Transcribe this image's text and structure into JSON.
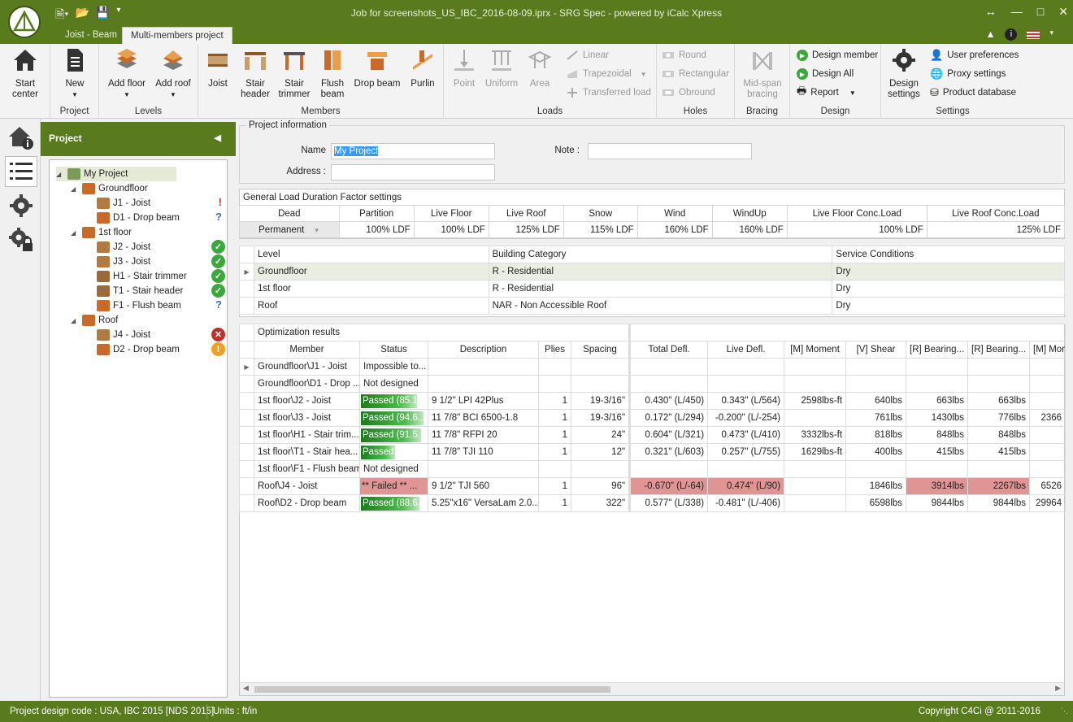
{
  "window": {
    "title": "Job for screenshots_US_IBC_2016-08-09.iprx - SRG Spec - powered by iCalc Xpress",
    "tabs": [
      "Joist - Beam",
      "Multi-members project"
    ],
    "active_tab": "Multi-members project"
  },
  "ribbon": {
    "project": {
      "label": "Project",
      "start_center": "Start center",
      "new": "New"
    },
    "levels": {
      "label": "Levels",
      "add_floor": "Add floor",
      "add_roof": "Add roof"
    },
    "members": {
      "label": "Members",
      "joist": "Joist",
      "stair_header": "Stair header",
      "stair_trimmer": "Stair trimmer",
      "flush_beam": "Flush beam",
      "drop_beam": "Drop beam",
      "purlin": "Purlin"
    },
    "loads": {
      "label": "Loads",
      "point": "Point",
      "uniform": "Uniform",
      "area": "Area",
      "linear": "Linear",
      "trapezoidal": "Trapezoidal",
      "transferred": "Transferred load"
    },
    "holes": {
      "label": "Holes",
      "round": "Round",
      "rectangular": "Rectangular",
      "obround": "Obround"
    },
    "bracing": {
      "label": "Bracing",
      "midspan": "Mid-span bracing"
    },
    "design": {
      "label": "Design",
      "design_member": "Design member",
      "design_all": "Design All",
      "report": "Report"
    },
    "settings": {
      "label": "Settings",
      "design_settings": "Design settings",
      "user_prefs": "User preferences",
      "proxy": "Proxy settings",
      "product_db": "Product database"
    }
  },
  "project_panel": {
    "title": "Project",
    "tree": [
      {
        "label": "My Project",
        "level": 0,
        "status": "",
        "kind": "project"
      },
      {
        "label": "Groundfloor",
        "level": 1,
        "status": "",
        "kind": "level"
      },
      {
        "label": "J1 - Joist",
        "level": 2,
        "status": "warn-red",
        "kind": "joist"
      },
      {
        "label": "D1 - Drop beam",
        "level": 2,
        "status": "question",
        "kind": "beam"
      },
      {
        "label": "1st floor",
        "level": 1,
        "status": "",
        "kind": "level"
      },
      {
        "label": "J2 - Joist",
        "level": 2,
        "status": "ok",
        "kind": "joist"
      },
      {
        "label": "J3 - Joist",
        "level": 2,
        "status": "ok",
        "kind": "joist"
      },
      {
        "label": "H1 - Stair trimmer",
        "level": 2,
        "status": "ok",
        "kind": "stair"
      },
      {
        "label": "T1 - Stair header",
        "level": 2,
        "status": "ok",
        "kind": "stair"
      },
      {
        "label": "F1 - Flush beam",
        "level": 2,
        "status": "question",
        "kind": "beam"
      },
      {
        "label": "Roof",
        "level": 1,
        "status": "",
        "kind": "level"
      },
      {
        "label": "J4 - Joist",
        "level": 2,
        "status": "fail",
        "kind": "joist"
      },
      {
        "label": "D2 - Drop beam",
        "level": 2,
        "status": "alert",
        "kind": "beam"
      }
    ]
  },
  "project_info": {
    "legend": "Project information",
    "name_label": "Name",
    "name_value": "My Project",
    "note_label": "Note :",
    "address_label": "Address :"
  },
  "ldf": {
    "title": "General Load Duration Factor settings",
    "headers": [
      "Dead",
      "Partition",
      "Live Floor",
      "Live Roof",
      "Snow",
      "Wind",
      "WindUp",
      "Live Floor Conc.Load",
      "Live Roof Conc.Load"
    ],
    "values": [
      "Permanent",
      "100% LDF",
      "100% LDF",
      "125% LDF",
      "115% LDF",
      "160% LDF",
      "160% LDF",
      "100% LDF",
      "125% LDF"
    ]
  },
  "levels": {
    "headers": [
      "Level",
      "Building Category",
      "Service Conditions"
    ],
    "rows": [
      [
        "Groundfloor",
        "R - Residential",
        "Dry"
      ],
      [
        "1st floor",
        "R - Residential",
        "Dry"
      ],
      [
        "Roof",
        "NAR - Non Accessible Roof",
        "Dry"
      ]
    ]
  },
  "results": {
    "title": "Optimization results",
    "headers": [
      "Member",
      "Status",
      "Description",
      "Plies",
      "Spacing",
      "Total Defl.",
      "Live Defl.",
      "[M] Moment",
      "[V] Shear",
      "[R] Bearing...",
      "[R] Bearing...",
      "[M] Mom"
    ],
    "rows": [
      {
        "member": "Groundfloor\\J1 - Joist",
        "status": "Impossible to...",
        "pct": 0,
        "fail": false,
        "desc": "",
        "plies": "",
        "spacing": "",
        "total": "",
        "live": "",
        "moment": "",
        "shear": "",
        "b1": "",
        "b2": "",
        "m2": "",
        "hl": []
      },
      {
        "member": "Groundfloor\\D1 - Drop ...",
        "status": "Not designed",
        "pct": 0,
        "fail": false,
        "desc": "",
        "plies": "",
        "spacing": "",
        "total": "",
        "live": "",
        "moment": "",
        "shear": "",
        "b1": "",
        "b2": "",
        "m2": "",
        "hl": []
      },
      {
        "member": "1st floor\\J2 - Joist",
        "status": "Passed (85.1...",
        "pct": 85,
        "fail": false,
        "desc": "9 1/2\" LPI 42Plus",
        "plies": "1",
        "spacing": "19-3/16\"",
        "total": "0.430\" (L/450)",
        "live": "0.343\" (L/564)",
        "moment": "2598lbs-ft",
        "shear": "640lbs",
        "b1": "663lbs",
        "b2": "663lbs",
        "m2": "",
        "hl": []
      },
      {
        "member": "1st floor\\J3 - Joist",
        "status": "Passed (94.6...",
        "pct": 95,
        "fail": false,
        "desc": "11 7/8\" BCI 6500-1.8",
        "plies": "1",
        "spacing": "19-3/16\"",
        "total": "0.172\" (L/294)",
        "live": "-0.200\" (L/-254)",
        "moment": "",
        "shear": "761lbs",
        "b1": "1430lbs",
        "b2": "776lbs",
        "m2": "2366",
        "hl": []
      },
      {
        "member": "1st floor\\H1 - Stair trim...",
        "status": "Passed (91.5...",
        "pct": 91,
        "fail": false,
        "desc": "11 7/8\" RFPI 20",
        "plies": "1",
        "spacing": "24\"",
        "total": "0.604\" (L/321)",
        "live": "0.473\" (L/410)",
        "moment": "3332lbs-ft",
        "shear": "818lbs",
        "b1": "848lbs",
        "b2": "848lbs",
        "m2": "",
        "hl": []
      },
      {
        "member": "1st floor\\T1 - Stair hea...",
        "status": "Passed (51.5...",
        "pct": 52,
        "fail": false,
        "desc": "11 7/8\" TJI 110",
        "plies": "1",
        "spacing": "12\"",
        "total": "0.321\" (L/603)",
        "live": "0.257\" (L/755)",
        "moment": "1629lbs-ft",
        "shear": "400lbs",
        "b1": "415lbs",
        "b2": "415lbs",
        "m2": "",
        "hl": []
      },
      {
        "member": "1st floor\\F1 - Flush beam",
        "status": "Not designed",
        "pct": 0,
        "fail": false,
        "desc": "",
        "plies": "",
        "spacing": "",
        "total": "",
        "live": "",
        "moment": "",
        "shear": "",
        "b1": "",
        "b2": "",
        "m2": "",
        "hl": []
      },
      {
        "member": "Roof\\J4 - Joist",
        "status": "** Failed ** ...",
        "pct": 0,
        "fail": true,
        "desc": "9 1/2\" TJI 560",
        "plies": "1",
        "spacing": "96\"",
        "total": "-0.670\" (L/-64)",
        "live": "0.474\" (L/90)",
        "moment": "",
        "shear": "1846lbs",
        "b1": "3914lbs",
        "b2": "2267lbs",
        "m2": "6526",
        "hl": [
          "total",
          "live",
          "b1",
          "b2"
        ]
      },
      {
        "member": "Roof\\D2 - Drop beam",
        "status": "Passed (88.6...",
        "pct": 89,
        "fail": false,
        "desc": "5.25\"x16\" VersaLam 2.0...",
        "plies": "1",
        "spacing": "322\"",
        "total": "0.577\" (L/338)",
        "live": "-0.481\" (L/-406)",
        "moment": "",
        "shear": "6598lbs",
        "b1": "9844lbs",
        "b2": "9844lbs",
        "m2": "29964",
        "hl": []
      }
    ]
  },
  "statusbar": {
    "design_code": "Project design code : USA, IBC 2015 [NDS 2015]",
    "units": "Units : ft/in",
    "copyright": "Copyright C4Ci @ 2011-2016"
  },
  "colors": {
    "brand": "#5a7a1e",
    "ok": "#3aa83a",
    "fail_cell": "#e09595"
  }
}
